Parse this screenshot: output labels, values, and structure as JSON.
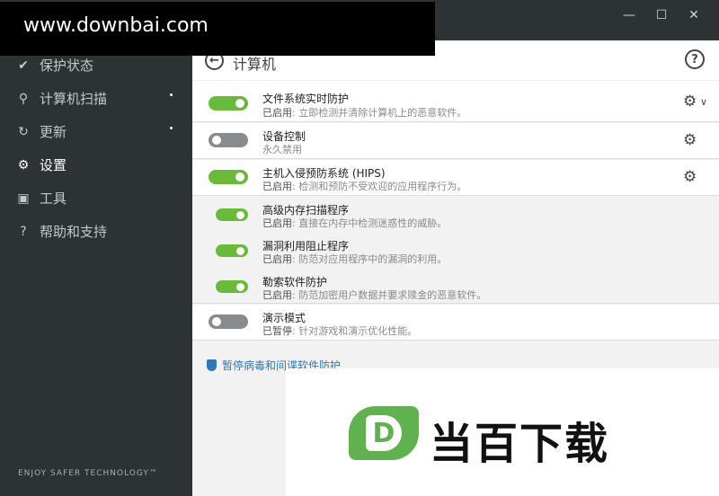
{
  "window": {
    "minimize_glyph": "—",
    "maximize_glyph": "☐",
    "close_glyph": "✕"
  },
  "watermark": {
    "url": "www.downbai.com",
    "logo_letter": "D",
    "logo_text": "当百下载",
    "logo_color": "#5fb24e"
  },
  "sidebar": {
    "items": [
      {
        "label": "保护状态",
        "icon": "check-icon",
        "glyph": "✔"
      },
      {
        "label": "计算机扫描",
        "icon": "search-icon",
        "glyph": "⚲"
      },
      {
        "label": "更新",
        "icon": "refresh-icon",
        "glyph": "↻"
      },
      {
        "label": "设置",
        "icon": "gear-icon",
        "glyph": "⚙"
      },
      {
        "label": "工具",
        "icon": "toolbox-icon",
        "glyph": "▣"
      },
      {
        "label": "帮助和支持",
        "icon": "help-icon",
        "glyph": "?"
      }
    ],
    "tagline": "ENJOY SAFER TECHNOLOGY™"
  },
  "header": {
    "title": "计算机",
    "back_glyph": "←",
    "help_glyph": "?"
  },
  "rows": [
    {
      "title": "文件系统实时防护",
      "lead": "已启用",
      "desc": ": 立即检测并清除计算机上的恶意软件。",
      "state": "on"
    },
    {
      "title": "设备控制",
      "lead": "",
      "desc": "永久禁用",
      "state": "off"
    },
    {
      "title": "主机入侵预防系统 (HIPS)",
      "lead": "已启用",
      "desc": ": 检测和预防不受欢迎的应用程序行为。",
      "state": "on"
    },
    {
      "title": "高级内存扫描程序",
      "lead": "已启用",
      "desc": ": 直接在内存中检测迷惑性的威胁。",
      "state": "on"
    },
    {
      "title": "漏洞利用阻止程序",
      "lead": "已启用",
      "desc": ": 防范对应用程序中的漏洞的利用。",
      "state": "on"
    },
    {
      "title": "勒索软件防护",
      "lead": "已启用",
      "desc": ": 防范加密用户数据并要求赎金的恶意软件。",
      "state": "on"
    },
    {
      "title": "演示模式",
      "lead": "已暂停",
      "desc": ": 针对游戏和演示优化性能。",
      "state": "off"
    }
  ],
  "gear_glyph": "⚙",
  "chevron_glyph": "∨",
  "pause_link": "暂停病毒和间谍软件防护",
  "colors": {
    "toggle_on": "#6aba3a",
    "toggle_off": "#888b8d",
    "link": "#2f78b8",
    "sidebar_bg": "#2d3235"
  }
}
